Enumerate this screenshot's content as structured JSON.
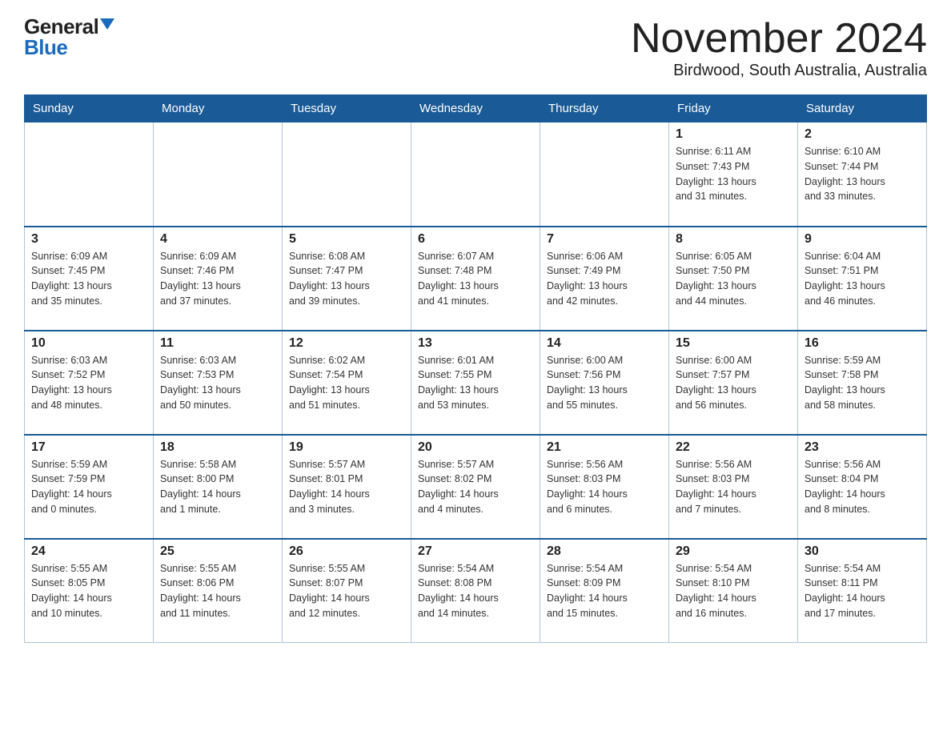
{
  "logo": {
    "general": "General",
    "blue": "Blue"
  },
  "title": "November 2024",
  "location": "Birdwood, South Australia, Australia",
  "weekdays": [
    "Sunday",
    "Monday",
    "Tuesday",
    "Wednesday",
    "Thursday",
    "Friday",
    "Saturday"
  ],
  "weeks": [
    [
      {
        "day": "",
        "info": ""
      },
      {
        "day": "",
        "info": ""
      },
      {
        "day": "",
        "info": ""
      },
      {
        "day": "",
        "info": ""
      },
      {
        "day": "",
        "info": ""
      },
      {
        "day": "1",
        "info": "Sunrise: 6:11 AM\nSunset: 7:43 PM\nDaylight: 13 hours\nand 31 minutes."
      },
      {
        "day": "2",
        "info": "Sunrise: 6:10 AM\nSunset: 7:44 PM\nDaylight: 13 hours\nand 33 minutes."
      }
    ],
    [
      {
        "day": "3",
        "info": "Sunrise: 6:09 AM\nSunset: 7:45 PM\nDaylight: 13 hours\nand 35 minutes."
      },
      {
        "day": "4",
        "info": "Sunrise: 6:09 AM\nSunset: 7:46 PM\nDaylight: 13 hours\nand 37 minutes."
      },
      {
        "day": "5",
        "info": "Sunrise: 6:08 AM\nSunset: 7:47 PM\nDaylight: 13 hours\nand 39 minutes."
      },
      {
        "day": "6",
        "info": "Sunrise: 6:07 AM\nSunset: 7:48 PM\nDaylight: 13 hours\nand 41 minutes."
      },
      {
        "day": "7",
        "info": "Sunrise: 6:06 AM\nSunset: 7:49 PM\nDaylight: 13 hours\nand 42 minutes."
      },
      {
        "day": "8",
        "info": "Sunrise: 6:05 AM\nSunset: 7:50 PM\nDaylight: 13 hours\nand 44 minutes."
      },
      {
        "day": "9",
        "info": "Sunrise: 6:04 AM\nSunset: 7:51 PM\nDaylight: 13 hours\nand 46 minutes."
      }
    ],
    [
      {
        "day": "10",
        "info": "Sunrise: 6:03 AM\nSunset: 7:52 PM\nDaylight: 13 hours\nand 48 minutes."
      },
      {
        "day": "11",
        "info": "Sunrise: 6:03 AM\nSunset: 7:53 PM\nDaylight: 13 hours\nand 50 minutes."
      },
      {
        "day": "12",
        "info": "Sunrise: 6:02 AM\nSunset: 7:54 PM\nDaylight: 13 hours\nand 51 minutes."
      },
      {
        "day": "13",
        "info": "Sunrise: 6:01 AM\nSunset: 7:55 PM\nDaylight: 13 hours\nand 53 minutes."
      },
      {
        "day": "14",
        "info": "Sunrise: 6:00 AM\nSunset: 7:56 PM\nDaylight: 13 hours\nand 55 minutes."
      },
      {
        "day": "15",
        "info": "Sunrise: 6:00 AM\nSunset: 7:57 PM\nDaylight: 13 hours\nand 56 minutes."
      },
      {
        "day": "16",
        "info": "Sunrise: 5:59 AM\nSunset: 7:58 PM\nDaylight: 13 hours\nand 58 minutes."
      }
    ],
    [
      {
        "day": "17",
        "info": "Sunrise: 5:59 AM\nSunset: 7:59 PM\nDaylight: 14 hours\nand 0 minutes."
      },
      {
        "day": "18",
        "info": "Sunrise: 5:58 AM\nSunset: 8:00 PM\nDaylight: 14 hours\nand 1 minute."
      },
      {
        "day": "19",
        "info": "Sunrise: 5:57 AM\nSunset: 8:01 PM\nDaylight: 14 hours\nand 3 minutes."
      },
      {
        "day": "20",
        "info": "Sunrise: 5:57 AM\nSunset: 8:02 PM\nDaylight: 14 hours\nand 4 minutes."
      },
      {
        "day": "21",
        "info": "Sunrise: 5:56 AM\nSunset: 8:03 PM\nDaylight: 14 hours\nand 6 minutes."
      },
      {
        "day": "22",
        "info": "Sunrise: 5:56 AM\nSunset: 8:03 PM\nDaylight: 14 hours\nand 7 minutes."
      },
      {
        "day": "23",
        "info": "Sunrise: 5:56 AM\nSunset: 8:04 PM\nDaylight: 14 hours\nand 8 minutes."
      }
    ],
    [
      {
        "day": "24",
        "info": "Sunrise: 5:55 AM\nSunset: 8:05 PM\nDaylight: 14 hours\nand 10 minutes."
      },
      {
        "day": "25",
        "info": "Sunrise: 5:55 AM\nSunset: 8:06 PM\nDaylight: 14 hours\nand 11 minutes."
      },
      {
        "day": "26",
        "info": "Sunrise: 5:55 AM\nSunset: 8:07 PM\nDaylight: 14 hours\nand 12 minutes."
      },
      {
        "day": "27",
        "info": "Sunrise: 5:54 AM\nSunset: 8:08 PM\nDaylight: 14 hours\nand 14 minutes."
      },
      {
        "day": "28",
        "info": "Sunrise: 5:54 AM\nSunset: 8:09 PM\nDaylight: 14 hours\nand 15 minutes."
      },
      {
        "day": "29",
        "info": "Sunrise: 5:54 AM\nSunset: 8:10 PM\nDaylight: 14 hours\nand 16 minutes."
      },
      {
        "day": "30",
        "info": "Sunrise: 5:54 AM\nSunset: 8:11 PM\nDaylight: 14 hours\nand 17 minutes."
      }
    ]
  ]
}
